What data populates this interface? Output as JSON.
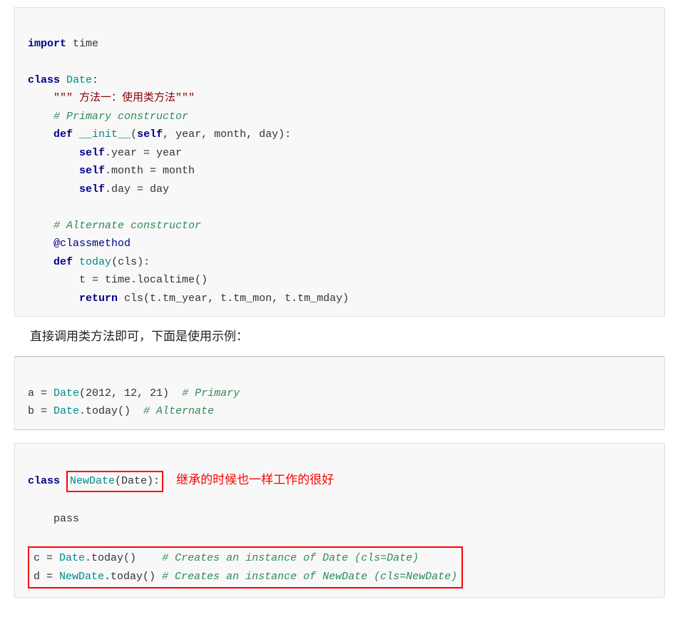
{
  "code1": {
    "lines": [
      {
        "type": "normal",
        "content": "import time"
      },
      {
        "type": "blank"
      },
      {
        "type": "normal",
        "content": "class Date:"
      },
      {
        "type": "normal",
        "content": "    \"\"\" 方法一：使用类方法\"\"\""
      },
      {
        "type": "normal",
        "content": "    # Primary constructor"
      },
      {
        "type": "normal",
        "content": "    def __init__(self, year, month, day):"
      },
      {
        "type": "normal",
        "content": "        self.year = year"
      },
      {
        "type": "normal",
        "content": "        self.month = month"
      },
      {
        "type": "normal",
        "content": "        self.day = day"
      },
      {
        "type": "blank"
      },
      {
        "type": "normal",
        "content": "    # Alternate constructor"
      },
      {
        "type": "normal",
        "content": "    @classmethod"
      },
      {
        "type": "normal",
        "content": "    def today(cls):"
      },
      {
        "type": "normal",
        "content": "        t = time.localtime()"
      },
      {
        "type": "normal",
        "content": "        return cls(t.tm_year, t.tm_mon, t.tm_mday)"
      }
    ]
  },
  "prose1": "直接调用类方法即可，下面是使用示例：",
  "code2": {
    "lines": [
      "a = Date(2012, 12, 21)  # Primary",
      "b = Date.today()  # Alternate"
    ]
  },
  "code3": {
    "class_line_before": "class ",
    "class_name_boxed": "NewDate(Date):",
    "class_annotation": "继承的时候也一样工作的很好",
    "pass_line": "    pass",
    "bottom_lines": [
      "c = Date.today()    # Creates an instance of Date (cls=Date)",
      "d = NewDate.today() # Creates an instance of NewDate (cls=NewDate)"
    ]
  }
}
